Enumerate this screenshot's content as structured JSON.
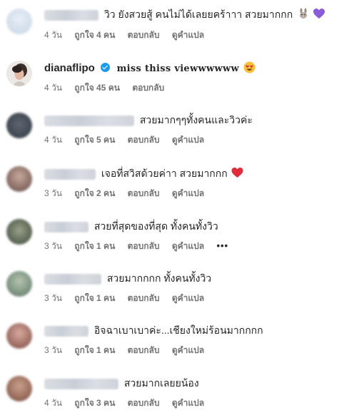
{
  "comments": [
    {
      "text": "วิว ยังสวยสู้ คนไม่ได้เลยยคร้าาา สวยมากกก",
      "time": "4 วัน",
      "likes": "ถูกใจ 4 คน",
      "reply": "ตอบกลับ",
      "translate": "ดูคำแปล"
    },
    {
      "username": "dianaflipo",
      "text": "miss thiss viewwwwww",
      "time": "4 วัน",
      "likes": "ถูกใจ 45 คน",
      "reply": "ตอบกลับ"
    },
    {
      "text": "สวยมากๆๆทั้งคนและวิวค่ะ",
      "time": "4 วัน",
      "likes": "ถูกใจ 5 คน",
      "reply": "ตอบกลับ",
      "translate": "ดูคำแปล"
    },
    {
      "text": "เจอที่สวิสด้วยค่าา สวยมากกก",
      "time": "3 วัน",
      "likes": "ถูกใจ 2 คน",
      "reply": "ตอบกลับ",
      "translate": "ดูคำแปล"
    },
    {
      "text": "สวยที่สุดของที่สุด ทั้งคนทั้งวิว",
      "time": "3 วัน",
      "likes": "ถูกใจ 1 คน",
      "reply": "ตอบกลับ",
      "translate": "ดูคำแปล",
      "more": "•••"
    },
    {
      "text": "สวยมากกกก ทั้งคนทั้งวิว",
      "time": "3 วัน",
      "likes": "ถูกใจ 1 คน",
      "reply": "ตอบกลับ",
      "translate": "ดูคำแปล"
    },
    {
      "text": "อิจฉาเบาเบาค่ะ...เชียงใหม่ร้อนมากกกก",
      "time": "3 วัน",
      "likes": "ถูกใจ 1 คน",
      "reply": "ตอบกลับ",
      "translate": "ดูคำแปล"
    },
    {
      "text": "สวยมากเลยยน้อง",
      "time": "4 วัน",
      "likes": "ถูกใจ 3 คน",
      "reply": "ตอบกลับ",
      "translate": "ดูคำแปล"
    }
  ],
  "icons": {
    "rabbit": "rabbit-emoji",
    "purple_heart": "purple-heart-emoji",
    "heart_eyes": "heart-eyes-emoji",
    "red_heart": "red-heart-emoji",
    "verified": "verified-badge-icon"
  },
  "colors": {
    "meta": "#737373",
    "text": "#262626",
    "verified": "#1d9bf0"
  }
}
